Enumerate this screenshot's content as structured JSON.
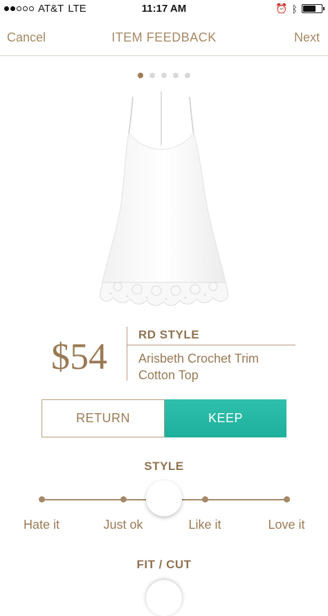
{
  "status_bar": {
    "carrier": "AT&T",
    "network": "LTE",
    "time": "11:17 AM"
  },
  "nav": {
    "cancel_label": "Cancel",
    "title": "ITEM FEEDBACK",
    "next_label": "Next"
  },
  "pager": {
    "count": 5,
    "active_index": 0
  },
  "product": {
    "price": "$54",
    "brand": "RD STYLE",
    "name": "Arisbeth Crochet Trim Cotton Top"
  },
  "actions": {
    "return_label": "RETURN",
    "keep_label": "KEEP",
    "keep_color": "#21b3a1"
  },
  "style_rating": {
    "title": "STYLE",
    "options": [
      "Hate it",
      "Just ok",
      "Like it",
      "Love it"
    ]
  },
  "fit_rating": {
    "title": "FIT / CUT"
  },
  "colors": {
    "accent_brown": "#9a7a55",
    "teal": "#21b3a1"
  }
}
